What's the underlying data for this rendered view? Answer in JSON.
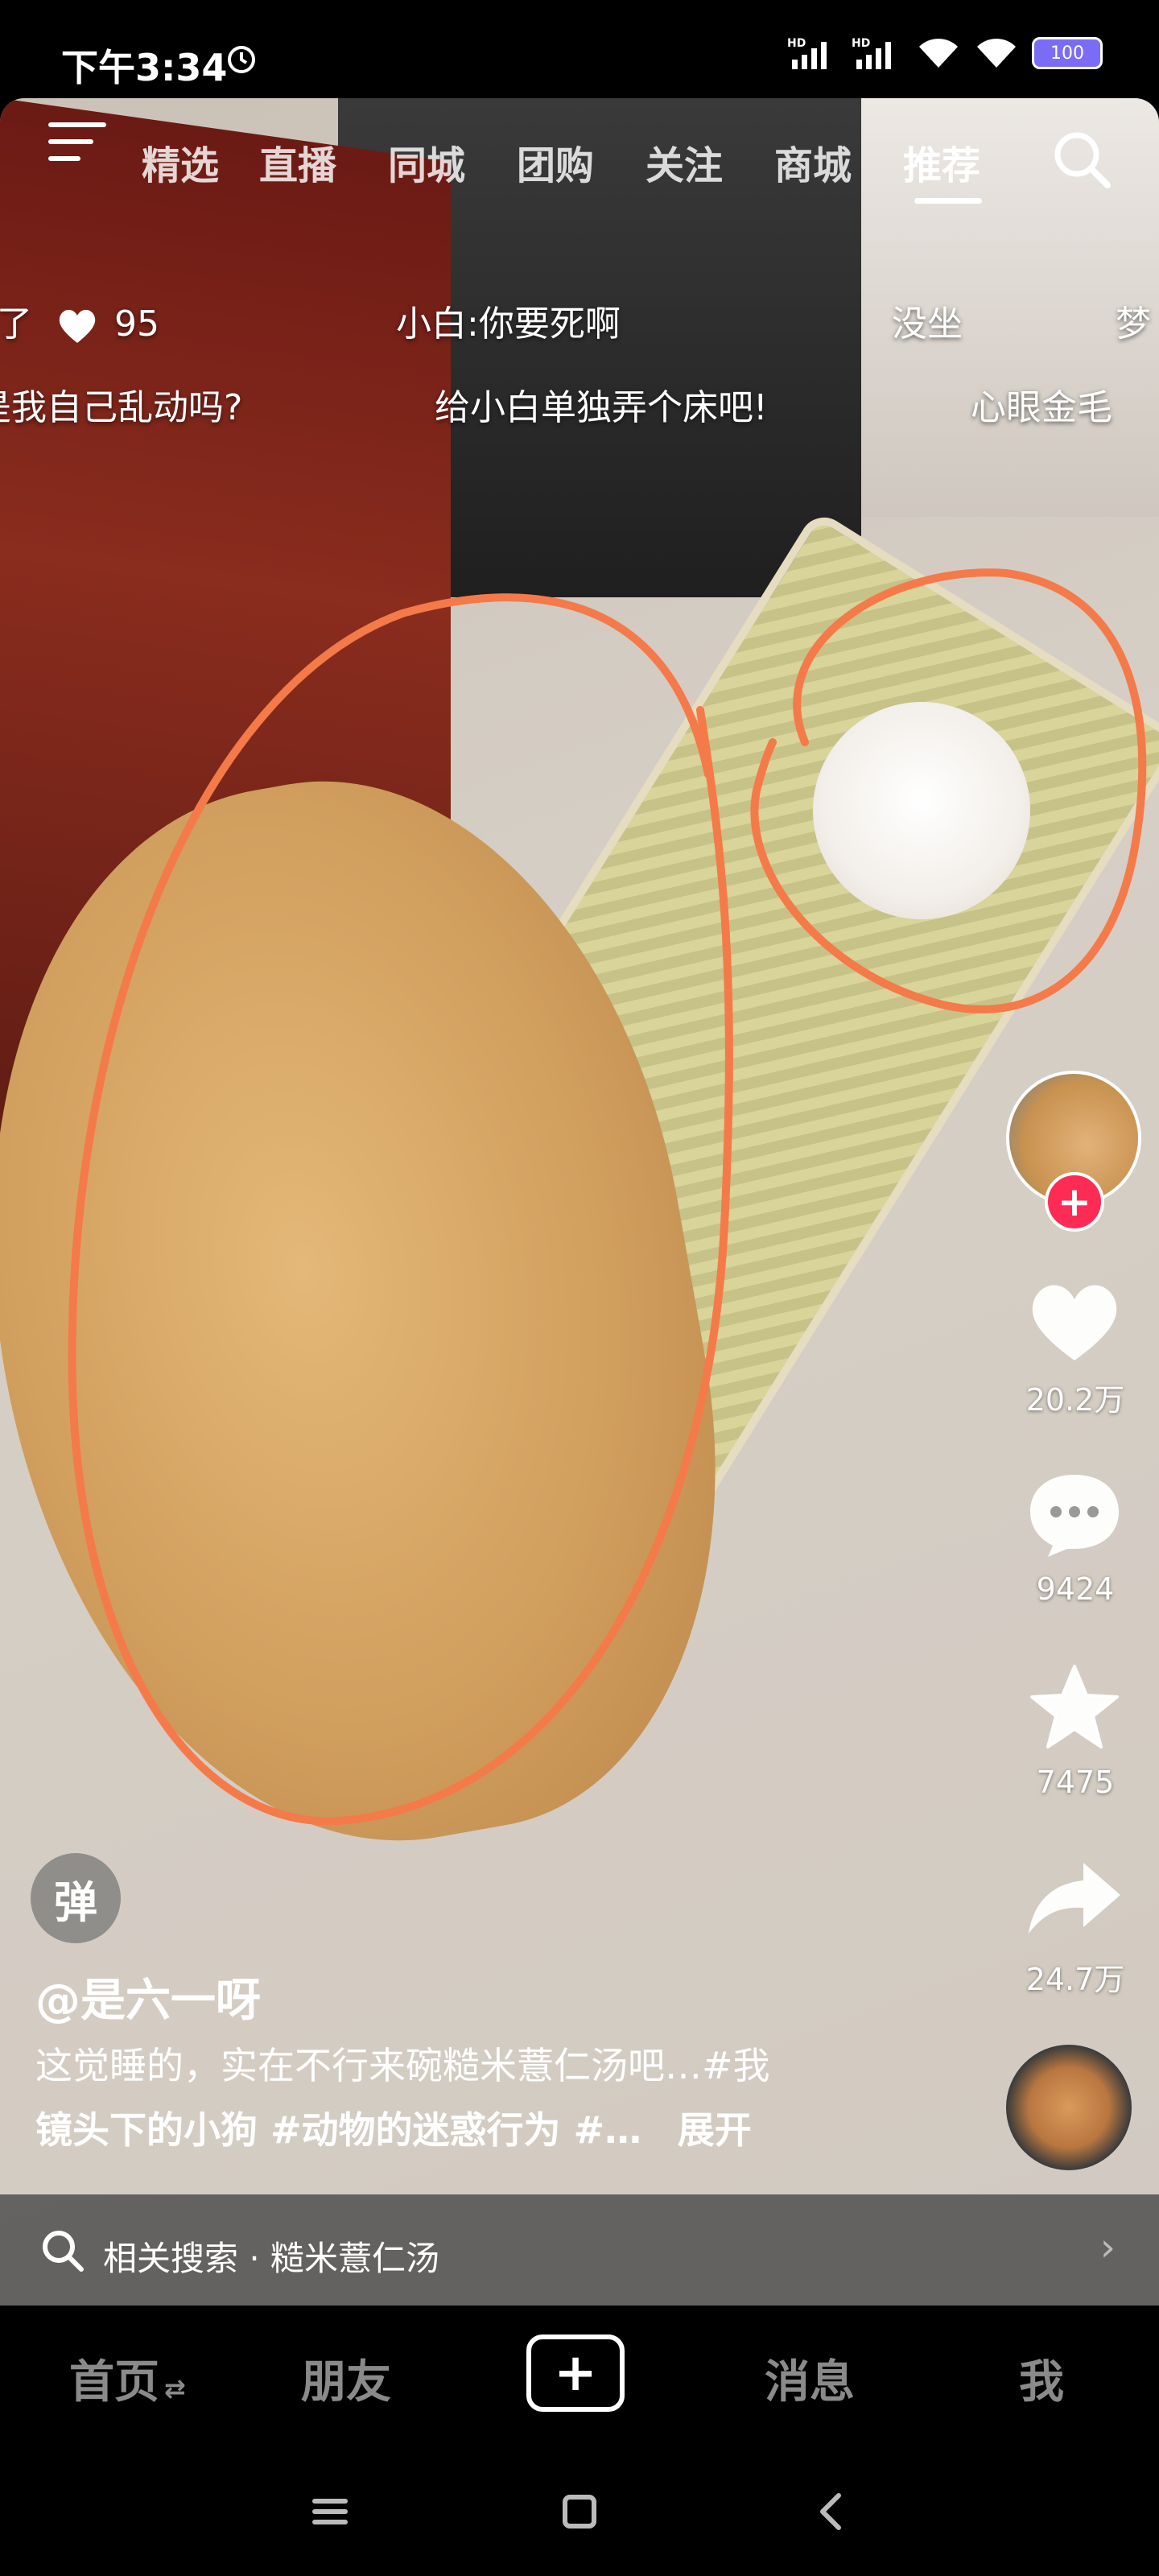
{
  "status_bar": {
    "time": "下午3:34",
    "battery": "100"
  },
  "top_nav": {
    "tabs": [
      "精选",
      "直播",
      "同城",
      "团购",
      "关注",
      "商城",
      "推荐"
    ],
    "active_tab": "推荐"
  },
  "danmaku": [
    {
      "text": "了",
      "likes": "95"
    },
    {
      "text": "小白:你要死啊"
    },
    {
      "text": "没坐"
    },
    {
      "text": "梦"
    },
    {
      "text": "是我自己乱动吗?"
    },
    {
      "text": "给小白单独弄个床吧!"
    },
    {
      "text": "心眼金毛"
    }
  ],
  "actions": {
    "likes": "20.2万",
    "comments": "9424",
    "favorites": "7475",
    "shares": "24.7万"
  },
  "danmu_toggle": "弹",
  "author": "@是六一呀",
  "caption": {
    "line1": "这觉睡的，实在不行来碗糙米薏仁汤吧…#我",
    "line2": "镜头下的小狗 #动物的迷惑行为 #…",
    "expand": "展开"
  },
  "related_search": {
    "label": "相关搜索 · 糙米薏仁汤"
  },
  "bottom_nav": {
    "home": "首页",
    "friends": "朋友",
    "messages": "消息",
    "me": "我"
  },
  "colors": {
    "accent": "#fe2c55",
    "annotation": "#f47a4a"
  }
}
